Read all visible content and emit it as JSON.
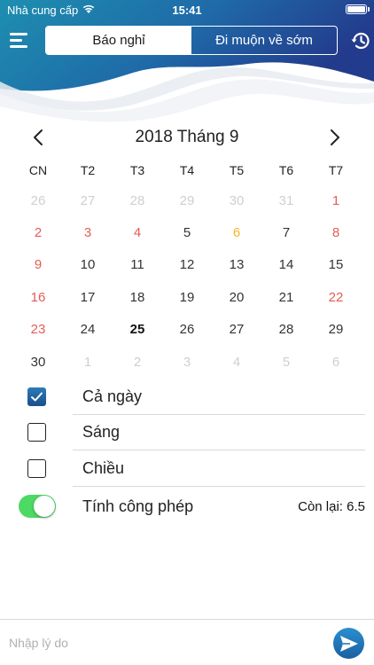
{
  "status_bar": {
    "carrier": "Nhà cung cấp",
    "time": "15:41"
  },
  "header": {
    "tabs": [
      {
        "label": "Báo nghỉ",
        "active": true
      },
      {
        "label": "Đi muộn về sớm",
        "active": false
      }
    ],
    "left_icon": "menu-icon",
    "right_icon": "history-icon",
    "gradient": [
      "#1d8fb0",
      "#233b8c"
    ]
  },
  "calendar": {
    "title": "2018 Tháng 9",
    "weekdays": [
      "CN",
      "T2",
      "T3",
      "T4",
      "T5",
      "T6",
      "T7"
    ],
    "days": [
      {
        "label": "26",
        "type": "other"
      },
      {
        "label": "27",
        "type": "other"
      },
      {
        "label": "28",
        "type": "other"
      },
      {
        "label": "29",
        "type": "other"
      },
      {
        "label": "30",
        "type": "other"
      },
      {
        "label": "31",
        "type": "other"
      },
      {
        "label": "1",
        "type": "weekend"
      },
      {
        "label": "2",
        "type": "weekend"
      },
      {
        "label": "3",
        "type": "weekend"
      },
      {
        "label": "4",
        "type": "weekend"
      },
      {
        "label": "5",
        "type": "normal"
      },
      {
        "label": "6",
        "type": "holiday"
      },
      {
        "label": "7",
        "type": "normal"
      },
      {
        "label": "8",
        "type": "weekend"
      },
      {
        "label": "9",
        "type": "weekend"
      },
      {
        "label": "10",
        "type": "normal"
      },
      {
        "label": "11",
        "type": "normal"
      },
      {
        "label": "12",
        "type": "normal"
      },
      {
        "label": "13",
        "type": "normal"
      },
      {
        "label": "14",
        "type": "normal"
      },
      {
        "label": "15",
        "type": "normal"
      },
      {
        "label": "16",
        "type": "weekend"
      },
      {
        "label": "17",
        "type": "normal"
      },
      {
        "label": "18",
        "type": "normal"
      },
      {
        "label": "19",
        "type": "normal"
      },
      {
        "label": "20",
        "type": "normal"
      },
      {
        "label": "21",
        "type": "normal"
      },
      {
        "label": "22",
        "type": "weekend"
      },
      {
        "label": "23",
        "type": "weekend"
      },
      {
        "label": "24",
        "type": "normal"
      },
      {
        "label": "25",
        "type": "today"
      },
      {
        "label": "26",
        "type": "normal"
      },
      {
        "label": "27",
        "type": "normal"
      },
      {
        "label": "28",
        "type": "normal"
      },
      {
        "label": "29",
        "type": "normal"
      },
      {
        "label": "30",
        "type": "normal"
      },
      {
        "label": "1",
        "type": "other"
      },
      {
        "label": "2",
        "type": "other"
      },
      {
        "label": "3",
        "type": "other"
      },
      {
        "label": "4",
        "type": "other"
      },
      {
        "label": "5",
        "type": "other"
      },
      {
        "label": "6",
        "type": "other"
      }
    ]
  },
  "options": {
    "full_day": {
      "label": "Cả ngày",
      "checked": true
    },
    "morning": {
      "label": "Sáng",
      "checked": false
    },
    "afternoon": {
      "label": "Chiều",
      "checked": false
    }
  },
  "leave": {
    "label": "Tính công phép",
    "enabled": true,
    "remaining": "Còn lại: 6.5"
  },
  "reason_input": {
    "placeholder": "Nhập lý do",
    "value": ""
  },
  "colors": {
    "accent": "#1b5fa0",
    "weekend": "#e35d57",
    "holiday": "#f2b722",
    "toggle_on": "#4cd964"
  },
  "send_icon": "send-icon"
}
